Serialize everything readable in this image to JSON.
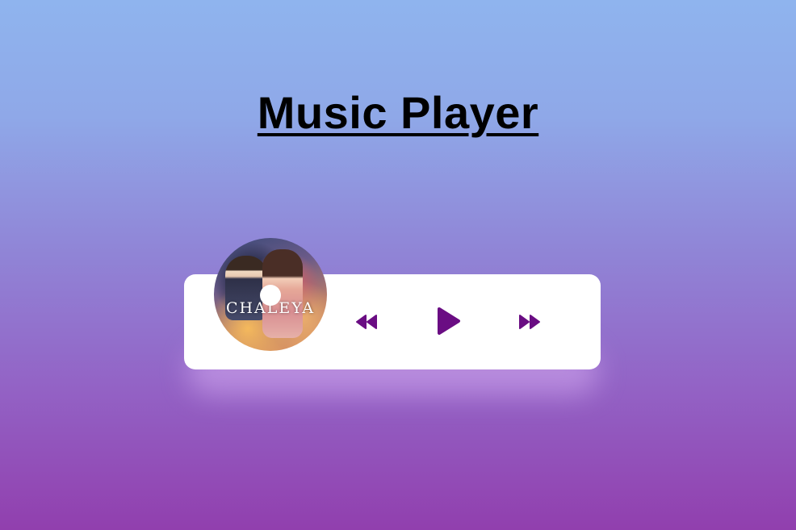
{
  "header": {
    "title": "Music Player"
  },
  "player": {
    "album_text": "CHALEYA",
    "controls": {
      "previous_icon": "backward-icon",
      "play_icon": "play-icon",
      "next_icon": "forward-icon"
    }
  },
  "colors": {
    "accent": "#6a0d83",
    "card": "#ffffff",
    "title": "#000000",
    "bg_top": "#8fb4ee",
    "bg_bottom": "#913fae"
  }
}
